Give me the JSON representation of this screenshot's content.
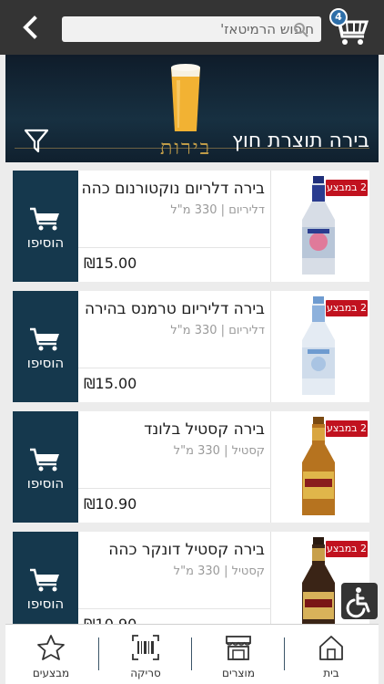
{
  "header": {
    "search_placeholder": "חיפוש הרמיטאז'",
    "cart_count": "4"
  },
  "banner": {
    "script_text": "בירות",
    "title": "בירה תוצרת חוץ"
  },
  "colors": {
    "topbar": "#343434",
    "add_button": "#15384d",
    "promo_badge": "#c1121f",
    "cart_badge": "#2d6ea8"
  },
  "products": [
    {
      "name": "בירה דלריום נוקטורנום כהה",
      "brand": "דליריום",
      "volume": "330 מ\"ל",
      "price": "₪15.00",
      "promo": "2 במבצע",
      "add_label": "הוסיפו"
    },
    {
      "name": "בירה דליריום טרמנס בהירה",
      "brand": "דליריום",
      "volume": "330 מ\"ל",
      "price": "₪15.00",
      "promo": "2 במבצע",
      "add_label": "הוסיפו"
    },
    {
      "name": "בירה קסטיל בלונד",
      "brand": "קסטיל",
      "volume": "330 מ\"ל",
      "price": "₪10.90",
      "promo": "2 במבצע",
      "add_label": "הוסיפו"
    },
    {
      "name": "בירה קסטיל דונקר כהה",
      "brand": "קסטיל",
      "volume": "330 מ\"ל",
      "price": "₪10.90",
      "promo": "2 במבצע",
      "add_label": "הוסיפו"
    }
  ],
  "bottom_nav": [
    {
      "label": "מבצעים",
      "icon": "star-icon"
    },
    {
      "label": "סריקה",
      "icon": "barcode-icon"
    },
    {
      "label": "מוצרים",
      "icon": "store-icon"
    },
    {
      "label": "בית",
      "icon": "home-icon"
    }
  ]
}
